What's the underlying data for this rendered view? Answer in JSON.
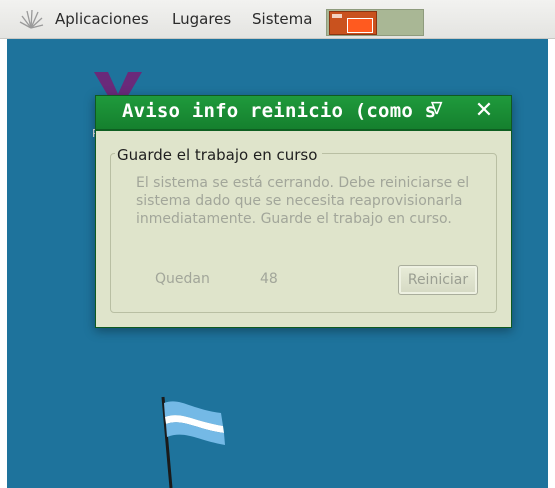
{
  "panel": {
    "menu_icon": "sunburst-icon",
    "menus": [
      "Aplicaciones",
      "Lugares",
      "Sistema"
    ]
  },
  "desktop": {
    "background_color": "#1e739c"
  },
  "dialog": {
    "title": "Aviso info reinicio (como s",
    "title_arrow": "∇",
    "close": "✕",
    "frame_label": "Guarde el trabajo en curso",
    "message": "El sistema se está cerrando. Debe reiniciarse el sistema dado que se necesita reaprovisionarla inmediatamente. Guarde el trabajo en curso.",
    "remaining_label": "Quedan",
    "remaining_value": "48",
    "restart_button": "Reiniciar",
    "titlebar_color": "#1a8e35"
  }
}
